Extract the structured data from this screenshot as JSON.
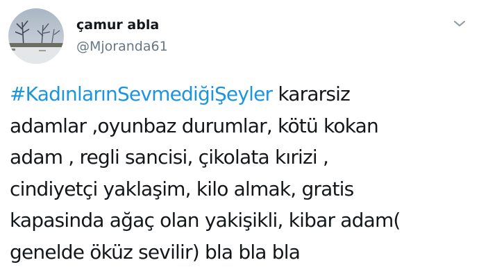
{
  "author": {
    "display_name": "çamur abla",
    "handle": "@Mjoranda61"
  },
  "menu": {
    "icon": "chevron-down-icon"
  },
  "tweet": {
    "hashtag": "#KadınlarınSevmediğiŞeyler",
    "first_line_rest": " kararsiz",
    "lines": [
      "adamlar ,oyunbaz durumlar, kötü kokan",
      "adam , regli sancisi, çikolata kırizi ,",
      "cindiyetçi yaklaşim, kilo almak, gratis",
      "kapasinda ağaç olan yakişikli, kibar adam(",
      "genelde öküz sevilir) bla bla bla"
    ]
  },
  "colors": {
    "hashtag": "#1b95e0",
    "text": "#14171a",
    "secondary": "#657786"
  }
}
